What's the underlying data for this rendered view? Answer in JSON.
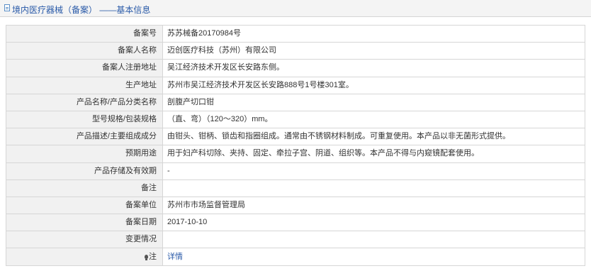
{
  "header": {
    "title": "境内医疗器械（备案） ——基本信息"
  },
  "rows": [
    {
      "label": "备案号",
      "value": "苏苏械备20170984号"
    },
    {
      "label": "备案人名称",
      "value": "迈创医疗科技（苏州）有限公司"
    },
    {
      "label": "备案人注册地址",
      "value": "吴江经济技术开发区长安路东侧。"
    },
    {
      "label": "生产地址",
      "value": "苏州市吴江经济技术开发区长安路888号1号楼301室。"
    },
    {
      "label": "产品名称/产品分类名称",
      "value": "剖腹产切口钳"
    },
    {
      "label": "型号规格/包装规格",
      "value": "（直、弯）（120～320）mm。"
    },
    {
      "label": "产品描述/主要组成成分",
      "value": "由钳头、钳柄、锁齿和指圈组成。通常由不锈钢材料制成。可重复使用。本产品以非无菌形式提供。"
    },
    {
      "label": "预期用途",
      "value": "用于妇产科切除、夹持、固定、牵拉子宫、阴道、组织等。本产品不得与内窥镜配套使用。"
    },
    {
      "label": "产品存储及有效期",
      "value": "-"
    },
    {
      "label": "备注",
      "value": ""
    },
    {
      "label": "备案单位",
      "value": "苏州市市场监督管理局"
    },
    {
      "label": "备案日期",
      "value": "2017-10-10"
    },
    {
      "label": "变更情况",
      "value": ""
    }
  ],
  "note_row": {
    "icon": "lightbulb-icon",
    "label": "注",
    "link_text": "详情"
  },
  "colors": {
    "title_blue": "#2a5aa8",
    "label_bg": "#f1f1f1",
    "border": "#d6d6d6"
  }
}
